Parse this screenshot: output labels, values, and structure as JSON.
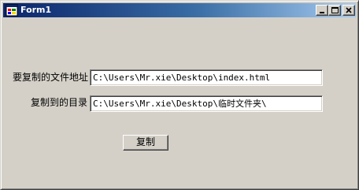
{
  "window": {
    "title": "Form1",
    "icon": "winforms-app-icon",
    "controls": {
      "minimize_icon": "minimize-icon",
      "maximize_icon": "maximize-icon",
      "close_icon": "close-icon"
    }
  },
  "form": {
    "source_label": "要复制的文件地址",
    "source_value": "C:\\Users\\Mr.xie\\Desktop\\index.html",
    "target_label": "复制到的目录",
    "target_value": "C:\\Users\\Mr.xie\\Desktop\\临时文件夹\\",
    "copy_button_label": "复制"
  },
  "colors": {
    "title_bar_start": "#0a246a",
    "title_bar_end": "#a6caf0",
    "face": "#d4d0c8",
    "input_background": "#ffffff"
  }
}
